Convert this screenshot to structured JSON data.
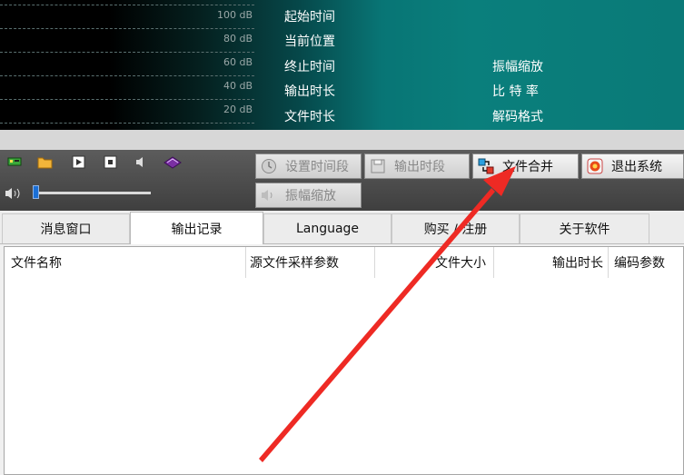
{
  "viz": {
    "db_levels": [
      "100 dB",
      "80 dB",
      "60 dB",
      "40 dB",
      "20 dB"
    ],
    "info_left": [
      "起始时间",
      "当前位置",
      "终止时间",
      "输出时长",
      "文件时长"
    ],
    "info_right": [
      "振幅缩放",
      "比 特 率",
      "解码格式"
    ]
  },
  "toolbar": {
    "set_segment": "设置时间段",
    "output_segment": "输出时段",
    "file_merge": "文件合并",
    "exit": "退出系统",
    "amplitude": "振幅缩放",
    "volume_level": 0.02
  },
  "tabs": [
    "消息窗口",
    "输出记录",
    "Language",
    "购买 / 注册",
    "关于软件"
  ],
  "active_tab": 1,
  "list": {
    "columns": [
      "文件名称",
      "源文件采样参数",
      "文件大小",
      "输出时长",
      "编码参数"
    ]
  },
  "colors": {
    "annotation_arrow": "#ee2a24",
    "accent_teal": "#0a7f7c"
  }
}
